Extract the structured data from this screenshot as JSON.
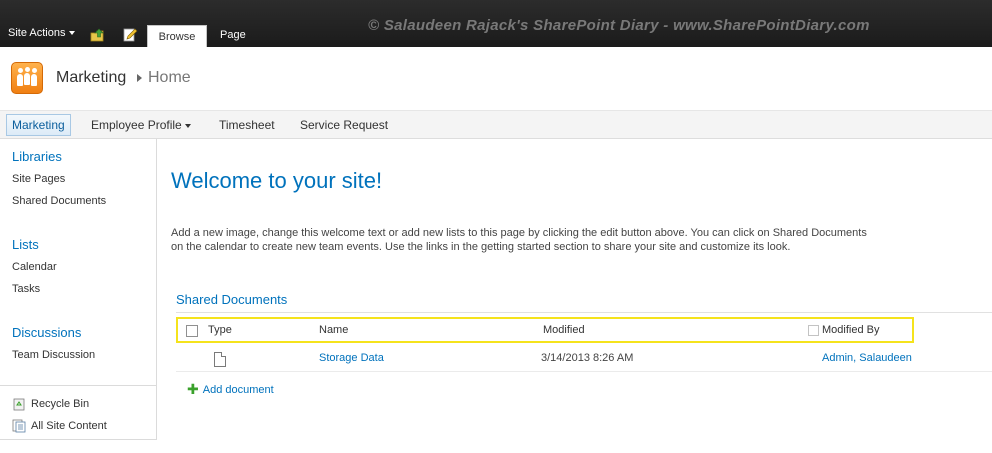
{
  "ribbon": {
    "site_actions": "Site Actions",
    "tabs": [
      "Browse",
      "Page"
    ],
    "watermark": "© Salaudeen Rajack's SharePoint Diary - www.SharePointDiary.com"
  },
  "header": {
    "site_title": "Marketing",
    "page_title": "Home"
  },
  "topnav": {
    "items": [
      "Marketing",
      "Employee Profile",
      "Timesheet",
      "Service Request"
    ]
  },
  "quicklaunch": {
    "libraries": {
      "heading": "Libraries",
      "items": [
        "Site Pages",
        "Shared Documents"
      ]
    },
    "lists": {
      "heading": "Lists",
      "items": [
        "Calendar",
        "Tasks"
      ]
    },
    "discussions": {
      "heading": "Discussions",
      "items": [
        "Team Discussion"
      ]
    },
    "footer": [
      "Recycle Bin",
      "All Site Content"
    ]
  },
  "main": {
    "welcome": "Welcome to your site!",
    "intro_line1": "Add a new image, change this welcome text or add new lists to this page by clicking the edit button above. You can click on Shared Documents",
    "intro_line2": "on the calendar to create new team events. Use the links in the getting started section to share your site and customize its look.",
    "webpart_title": "Shared Documents",
    "columns": [
      "Type",
      "Name",
      "Modified",
      "Modified By"
    ],
    "rows": [
      {
        "name": "Storage Data",
        "modified": "3/14/2013 8:26 AM",
        "modified_by": "Admin, Salaudeen"
      }
    ],
    "add_document": "Add document"
  },
  "colors": {
    "link": "#0072bc",
    "highlight": "#f5e31c",
    "ribbon": "#1b1b1b"
  },
  "icons": [
    "caret-down-icon",
    "navigate-up-icon",
    "edit-page-icon",
    "site-logo-icon",
    "breadcrumb-arrow-icon",
    "document-icon",
    "add-icon",
    "recycle-bin-icon",
    "all-site-content-icon"
  ]
}
